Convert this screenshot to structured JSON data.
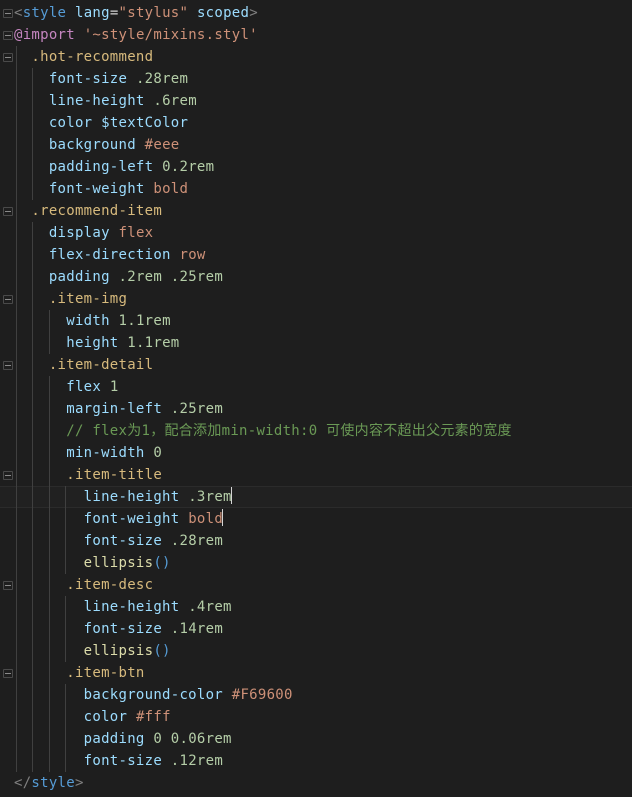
{
  "editor": {
    "language": "stylus",
    "theme": "dark-plus",
    "font_size_px": 14,
    "line_height_px": 22,
    "colors": {
      "background": "#1e1e1e",
      "current_line": "#212121",
      "foreground": "#d4d4d4",
      "tag": "#808080",
      "tag_name": "#569cd6",
      "attribute": "#9cdcfe",
      "string": "#ce9178",
      "at_rule": "#c586c0",
      "selector": "#d7ba7d",
      "property": "#9cdcfe",
      "number": "#b5cea8",
      "keyword_value": "#ce9178",
      "comment": "#6a9955",
      "function": "#dcdcaa",
      "paren": "#569cd6",
      "indent_guide": "#404040",
      "fold_marker": "#8a8a8a"
    },
    "cursor": {
      "line_index": 23,
      "after_text": ".3rem"
    },
    "lines": [
      {
        "index": 0,
        "indent": 0,
        "fold": true,
        "tokens": [
          {
            "text": "<",
            "cls": "t-tag"
          },
          {
            "text": "style",
            "cls": "t-tagname"
          },
          {
            "text": " ",
            "cls": "t-plain"
          },
          {
            "text": "lang",
            "cls": "t-attr"
          },
          {
            "text": "=",
            "cls": "t-eq"
          },
          {
            "text": "\"stylus\"",
            "cls": "t-str"
          },
          {
            "text": " ",
            "cls": "t-plain"
          },
          {
            "text": "scoped",
            "cls": "t-attr"
          },
          {
            "text": ">",
            "cls": "t-tag"
          }
        ]
      },
      {
        "index": 1,
        "indent": 0,
        "fold": true,
        "tokens": [
          {
            "text": "@import",
            "cls": "t-atrule"
          },
          {
            "text": " ",
            "cls": "t-plain"
          },
          {
            "text": "'~style/mixins.styl'",
            "cls": "t-str"
          }
        ]
      },
      {
        "index": 2,
        "indent": 1,
        "fold": true,
        "tokens": [
          {
            "text": "  ",
            "cls": "t-plain"
          },
          {
            "text": ".hot-recommend",
            "cls": "t-sel"
          }
        ]
      },
      {
        "index": 3,
        "indent": 2,
        "fold": false,
        "tokens": [
          {
            "text": "    ",
            "cls": "t-plain"
          },
          {
            "text": "font-size",
            "cls": "t-prop"
          },
          {
            "text": " ",
            "cls": "t-plain"
          },
          {
            "text": ".28rem",
            "cls": "t-num"
          }
        ]
      },
      {
        "index": 4,
        "indent": 2,
        "fold": false,
        "tokens": [
          {
            "text": "    ",
            "cls": "t-plain"
          },
          {
            "text": "line-height",
            "cls": "t-prop"
          },
          {
            "text": " ",
            "cls": "t-plain"
          },
          {
            "text": ".6rem",
            "cls": "t-num"
          }
        ]
      },
      {
        "index": 5,
        "indent": 2,
        "fold": false,
        "tokens": [
          {
            "text": "    ",
            "cls": "t-plain"
          },
          {
            "text": "color",
            "cls": "t-prop"
          },
          {
            "text": " ",
            "cls": "t-plain"
          },
          {
            "text": "$textColor",
            "cls": "t-var"
          }
        ]
      },
      {
        "index": 6,
        "indent": 2,
        "fold": false,
        "tokens": [
          {
            "text": "    ",
            "cls": "t-plain"
          },
          {
            "text": "background",
            "cls": "t-prop"
          },
          {
            "text": " ",
            "cls": "t-plain"
          },
          {
            "text": "#eee",
            "cls": "t-hex"
          }
        ]
      },
      {
        "index": 7,
        "indent": 2,
        "fold": false,
        "tokens": [
          {
            "text": "    ",
            "cls": "t-plain"
          },
          {
            "text": "padding-left",
            "cls": "t-prop"
          },
          {
            "text": " ",
            "cls": "t-plain"
          },
          {
            "text": "0.2rem",
            "cls": "t-num"
          }
        ]
      },
      {
        "index": 8,
        "indent": 2,
        "fold": false,
        "tokens": [
          {
            "text": "    ",
            "cls": "t-plain"
          },
          {
            "text": "font-weight",
            "cls": "t-prop"
          },
          {
            "text": " ",
            "cls": "t-plain"
          },
          {
            "text": "bold",
            "cls": "t-kw"
          }
        ]
      },
      {
        "index": 9,
        "indent": 1,
        "fold": true,
        "tokens": [
          {
            "text": "  ",
            "cls": "t-plain"
          },
          {
            "text": ".recommend-item",
            "cls": "t-sel"
          }
        ]
      },
      {
        "index": 10,
        "indent": 2,
        "fold": false,
        "tokens": [
          {
            "text": "    ",
            "cls": "t-plain"
          },
          {
            "text": "display",
            "cls": "t-prop"
          },
          {
            "text": " ",
            "cls": "t-plain"
          },
          {
            "text": "flex",
            "cls": "t-kw"
          }
        ]
      },
      {
        "index": 11,
        "indent": 2,
        "fold": false,
        "tokens": [
          {
            "text": "    ",
            "cls": "t-plain"
          },
          {
            "text": "flex-direction",
            "cls": "t-prop"
          },
          {
            "text": " ",
            "cls": "t-plain"
          },
          {
            "text": "row",
            "cls": "t-kw"
          }
        ]
      },
      {
        "index": 12,
        "indent": 2,
        "fold": false,
        "tokens": [
          {
            "text": "    ",
            "cls": "t-plain"
          },
          {
            "text": "padding",
            "cls": "t-prop"
          },
          {
            "text": " ",
            "cls": "t-plain"
          },
          {
            "text": ".2rem",
            "cls": "t-num"
          },
          {
            "text": " ",
            "cls": "t-plain"
          },
          {
            "text": ".25rem",
            "cls": "t-num"
          }
        ]
      },
      {
        "index": 13,
        "indent": 2,
        "fold": true,
        "tokens": [
          {
            "text": "    ",
            "cls": "t-plain"
          },
          {
            "text": ".item-img",
            "cls": "t-sel"
          }
        ]
      },
      {
        "index": 14,
        "indent": 3,
        "fold": false,
        "tokens": [
          {
            "text": "      ",
            "cls": "t-plain"
          },
          {
            "text": "width",
            "cls": "t-prop"
          },
          {
            "text": " ",
            "cls": "t-plain"
          },
          {
            "text": "1.1rem",
            "cls": "t-num"
          }
        ]
      },
      {
        "index": 15,
        "indent": 3,
        "fold": false,
        "tokens": [
          {
            "text": "      ",
            "cls": "t-plain"
          },
          {
            "text": "height",
            "cls": "t-prop"
          },
          {
            "text": " ",
            "cls": "t-plain"
          },
          {
            "text": "1.1rem",
            "cls": "t-num"
          }
        ]
      },
      {
        "index": 16,
        "indent": 2,
        "fold": true,
        "tokens": [
          {
            "text": "    ",
            "cls": "t-plain"
          },
          {
            "text": ".item-detail",
            "cls": "t-sel"
          }
        ]
      },
      {
        "index": 17,
        "indent": 3,
        "fold": false,
        "tokens": [
          {
            "text": "      ",
            "cls": "t-plain"
          },
          {
            "text": "flex",
            "cls": "t-prop"
          },
          {
            "text": " ",
            "cls": "t-plain"
          },
          {
            "text": "1",
            "cls": "t-num"
          }
        ]
      },
      {
        "index": 18,
        "indent": 3,
        "fold": false,
        "tokens": [
          {
            "text": "      ",
            "cls": "t-plain"
          },
          {
            "text": "margin-left",
            "cls": "t-prop"
          },
          {
            "text": " ",
            "cls": "t-plain"
          },
          {
            "text": ".25rem",
            "cls": "t-num"
          }
        ]
      },
      {
        "index": 19,
        "indent": 3,
        "fold": false,
        "tokens": [
          {
            "text": "      ",
            "cls": "t-plain"
          },
          {
            "text": "// flex为1，配合添加min-width:0 可使内容不超出父元素的宽度",
            "cls": "t-comment"
          }
        ]
      },
      {
        "index": 20,
        "indent": 3,
        "fold": false,
        "tokens": [
          {
            "text": "      ",
            "cls": "t-plain"
          },
          {
            "text": "min-width",
            "cls": "t-prop"
          },
          {
            "text": " ",
            "cls": "t-plain"
          },
          {
            "text": "0",
            "cls": "t-num"
          }
        ]
      },
      {
        "index": 21,
        "indent": 3,
        "fold": true,
        "tokens": [
          {
            "text": "      ",
            "cls": "t-plain"
          },
          {
            "text": ".item-title",
            "cls": "t-sel"
          }
        ]
      },
      {
        "index": 22,
        "indent": 4,
        "fold": false,
        "current": true,
        "tokens": [
          {
            "text": "        ",
            "cls": "t-plain"
          },
          {
            "text": "line-height",
            "cls": "t-prop"
          },
          {
            "text": " ",
            "cls": "t-plain"
          },
          {
            "text": ".3rem",
            "cls": "t-num"
          }
        ]
      },
      {
        "index": 23,
        "indent": 4,
        "fold": false,
        "tokens": [
          {
            "text": "        ",
            "cls": "t-plain"
          },
          {
            "text": "font-weight",
            "cls": "t-prop"
          },
          {
            "text": " ",
            "cls": "t-plain"
          },
          {
            "text": "bold",
            "cls": "t-kw"
          }
        ]
      },
      {
        "index": 24,
        "indent": 4,
        "fold": false,
        "tokens": [
          {
            "text": "        ",
            "cls": "t-plain"
          },
          {
            "text": "font-size",
            "cls": "t-prop"
          },
          {
            "text": " ",
            "cls": "t-plain"
          },
          {
            "text": ".28rem",
            "cls": "t-num"
          }
        ]
      },
      {
        "index": 25,
        "indent": 4,
        "fold": false,
        "tokens": [
          {
            "text": "        ",
            "cls": "t-plain"
          },
          {
            "text": "ellipsis",
            "cls": "t-fn"
          },
          {
            "text": "()",
            "cls": "t-paren"
          }
        ]
      },
      {
        "index": 26,
        "indent": 3,
        "fold": true,
        "tokens": [
          {
            "text": "      ",
            "cls": "t-plain"
          },
          {
            "text": ".item-desc",
            "cls": "t-sel"
          }
        ]
      },
      {
        "index": 27,
        "indent": 4,
        "fold": false,
        "tokens": [
          {
            "text": "        ",
            "cls": "t-plain"
          },
          {
            "text": "line-height",
            "cls": "t-prop"
          },
          {
            "text": " ",
            "cls": "t-plain"
          },
          {
            "text": ".4rem",
            "cls": "t-num"
          }
        ]
      },
      {
        "index": 28,
        "indent": 4,
        "fold": false,
        "tokens": [
          {
            "text": "        ",
            "cls": "t-plain"
          },
          {
            "text": "font-size",
            "cls": "t-prop"
          },
          {
            "text": " ",
            "cls": "t-plain"
          },
          {
            "text": ".14rem",
            "cls": "t-num"
          }
        ]
      },
      {
        "index": 29,
        "indent": 4,
        "fold": false,
        "tokens": [
          {
            "text": "        ",
            "cls": "t-plain"
          },
          {
            "text": "ellipsis",
            "cls": "t-fn"
          },
          {
            "text": "()",
            "cls": "t-paren"
          }
        ]
      },
      {
        "index": 30,
        "indent": 3,
        "fold": true,
        "tokens": [
          {
            "text": "      ",
            "cls": "t-plain"
          },
          {
            "text": ".item-btn",
            "cls": "t-sel"
          }
        ]
      },
      {
        "index": 31,
        "indent": 4,
        "fold": false,
        "tokens": [
          {
            "text": "        ",
            "cls": "t-plain"
          },
          {
            "text": "background-color",
            "cls": "t-prop"
          },
          {
            "text": " ",
            "cls": "t-plain"
          },
          {
            "text": "#F69600",
            "cls": "t-hex"
          }
        ]
      },
      {
        "index": 32,
        "indent": 4,
        "fold": false,
        "tokens": [
          {
            "text": "        ",
            "cls": "t-plain"
          },
          {
            "text": "color",
            "cls": "t-prop"
          },
          {
            "text": " ",
            "cls": "t-plain"
          },
          {
            "text": "#fff",
            "cls": "t-hex"
          }
        ]
      },
      {
        "index": 33,
        "indent": 4,
        "fold": false,
        "tokens": [
          {
            "text": "        ",
            "cls": "t-plain"
          },
          {
            "text": "padding",
            "cls": "t-prop"
          },
          {
            "text": " ",
            "cls": "t-plain"
          },
          {
            "text": "0",
            "cls": "t-num"
          },
          {
            "text": " ",
            "cls": "t-plain"
          },
          {
            "text": "0.06rem",
            "cls": "t-num"
          }
        ]
      },
      {
        "index": 34,
        "indent": 4,
        "fold": false,
        "tokens": [
          {
            "text": "        ",
            "cls": "t-plain"
          },
          {
            "text": "font-size",
            "cls": "t-prop"
          },
          {
            "text": " ",
            "cls": "t-plain"
          },
          {
            "text": ".12rem",
            "cls": "t-num"
          }
        ]
      },
      {
        "index": 35,
        "indent": 0,
        "fold": false,
        "tokens": [
          {
            "text": "</",
            "cls": "t-tag"
          },
          {
            "text": "style",
            "cls": "t-tagname"
          },
          {
            "text": ">",
            "cls": "t-tag"
          }
        ]
      }
    ]
  }
}
